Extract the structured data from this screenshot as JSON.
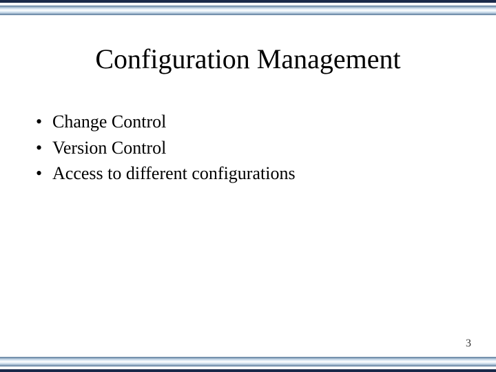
{
  "slide": {
    "title": "Configuration Management",
    "bullets": [
      "Change Control",
      "Version Control",
      "Access to different configurations"
    ],
    "page_number": "3"
  }
}
